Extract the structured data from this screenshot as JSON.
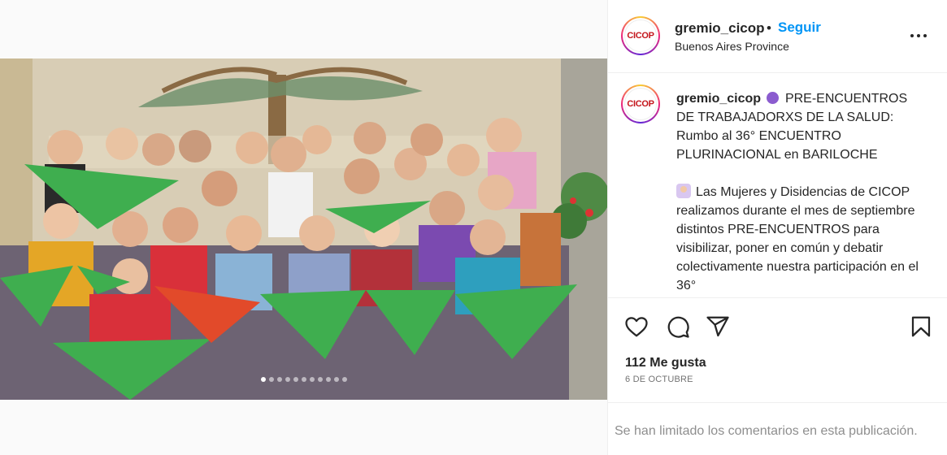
{
  "post": {
    "account": {
      "username": "gremio_cicop",
      "avatar_text": "CICOP",
      "location": "Buenos Aires Province"
    },
    "header": {
      "separator": "•",
      "follow_label": "Seguir",
      "more_icon": "more-horizontal-icon"
    },
    "caption": {
      "username": "gremio_cicop",
      "line1": "PRE-ENCUENTROS DE TRABAJADORXS DE LA SALUD: Rumbo al 36° ENCUENTRO PLURINACIONAL en BARILOCHE",
      "line2": "Las Mujeres y Disidencias de CICOP realizamos durante el mes de septiembre distintos PRE-ENCUENTROS para visibilizar, poner en común y debatir colectivamente nuestra participación en el 36°",
      "emoji_1": "purple-circle-icon",
      "emoji_2": "woman-raising-hand-icon"
    },
    "actions": {
      "like_icon": "heart-icon",
      "comment_icon": "comment-icon",
      "share_icon": "paper-plane-icon",
      "save_icon": "bookmark-icon"
    },
    "likes": "112 Me gusta",
    "date": "6 DE OCTUBRE",
    "comments_notice": "Se han limitado los comentarios en esta publicación.",
    "carousel": {
      "total": 11,
      "active": 1
    }
  },
  "colors": {
    "accent": "#0095f6",
    "text": "#262626",
    "muted": "#8e8e8e",
    "scarf_green": "#3fae4f"
  }
}
